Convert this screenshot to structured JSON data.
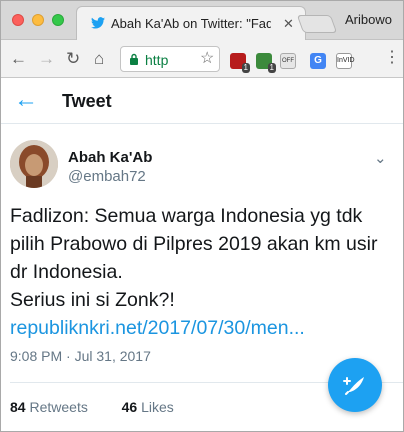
{
  "browser": {
    "tab_title": "Abah Ka'Ab on Twitter: \"Fadli",
    "tab_close": "✕",
    "profile_name": "Aribowo",
    "url": "http",
    "extensions": {
      "ext1_badge": "1",
      "ext2_badge": "1",
      "ext3_label": "OFF",
      "ext4_label": "G",
      "ext5_label": "InVID"
    }
  },
  "header": {
    "back": "←",
    "title": "Tweet"
  },
  "tweet": {
    "author_name": "Abah Ka'Ab",
    "author_handle": "@embah72",
    "lines": [
      "Fadlizon: Semua warga Indonesia yg tdk",
      "pilih Prabowo di Pilpres 2019 akan km usir",
      "dr Indonesia.",
      "Serius ini si Zonk?!"
    ],
    "link": "republiknkri.net/2017/07/30/men...",
    "timestamp": "9:08 PM · Jul 31, 2017",
    "retweets_count": "84",
    "retweets_label": "Retweets",
    "likes_count": "46",
    "likes_label": "Likes"
  },
  "colors": {
    "twitter_blue": "#1da1f2",
    "link_blue": "#1b95e0",
    "secure_green": "#0b8043"
  },
  "icons": {
    "tab_favicon": "twitter-bird-icon",
    "lock": "lock-icon",
    "star": "star-icon",
    "menu": "kebab-menu-icon",
    "caret": "chevron-down-icon",
    "fab": "compose-tweet-icon"
  }
}
